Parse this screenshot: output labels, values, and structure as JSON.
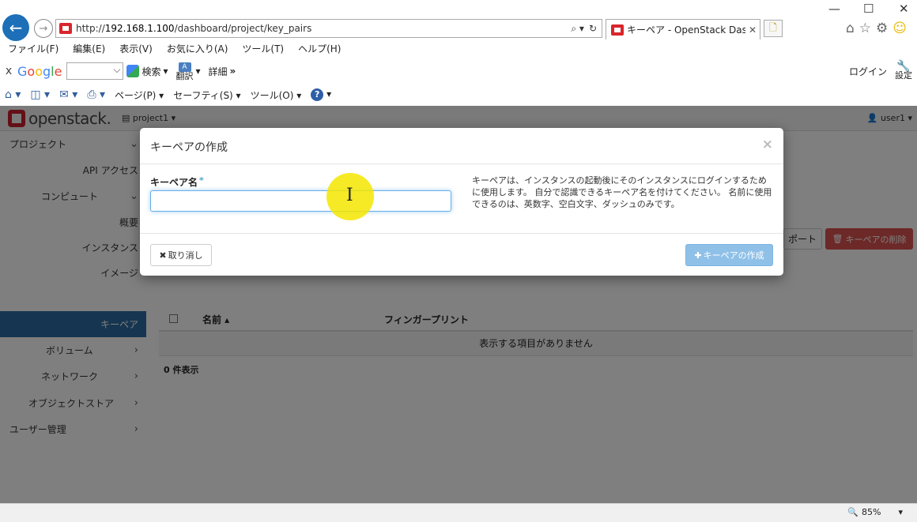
{
  "window": {
    "controls": {
      "minimize": "—",
      "maximize": "☐",
      "close": "✕"
    }
  },
  "browser": {
    "url_prefix": "http://",
    "url_host": "192.168.1.100",
    "url_path": "/dashboard/project/key_pairs",
    "addr_tools": [
      "⌕ ▾",
      "↻"
    ],
    "tab_title": "キーペア - OpenStack Dashb...",
    "tab_close": "✕",
    "new_tab": "🗋",
    "right_icons": [
      "⌂",
      "☆",
      "⚙",
      "☺"
    ],
    "menu": [
      "ファイル(F)",
      "編集(E)",
      "表示(V)",
      "お気に入り(A)",
      "ツール(T)",
      "ヘルプ(H)"
    ],
    "googlebar": {
      "close": "x",
      "logo": [
        "G",
        "o",
        "o",
        "g",
        "l",
        "e"
      ],
      "search_label": "検索",
      "translate_label": "翻訳",
      "detail_label": "詳細",
      "more": "»",
      "login": "ログイン",
      "settings": "設定"
    },
    "cmdbar": {
      "page": "ページ(P) ▾",
      "safety": "セーフティ(S) ▾",
      "tools": "ツール(O) ▾"
    },
    "zoom": "85%"
  },
  "openstack": {
    "brand": "openstack.",
    "project": "project1 ▾",
    "user": "user1 ▾"
  },
  "sidebar": {
    "items": [
      {
        "label": "プロジェクト",
        "chevron": "⌄"
      },
      {
        "label": "API アクセス"
      },
      {
        "label": "コンピュート",
        "chevron": "⌄"
      },
      {
        "label": "概要"
      },
      {
        "label": "インスタンス"
      },
      {
        "label": "イメージ"
      },
      {
        "label": "キーペア"
      },
      {
        "label": "ボリューム",
        "chevron": "›"
      },
      {
        "label": "ネットワーク",
        "chevron": "›"
      },
      {
        "label": "オブジェクトストア",
        "chevron": "›"
      },
      {
        "label": "ユーザー管理",
        "chevron": "›"
      }
    ]
  },
  "content": {
    "import_partial": "ポート",
    "delete_button": "キーペアの削除",
    "columns": {
      "name": "名前 ▴",
      "fingerprint": "フィンガープリント"
    },
    "empty": "表示する項目がありません",
    "count": "0 件表示"
  },
  "modal": {
    "title": "キーペアの作成",
    "close": "×",
    "field_label": "キーペア名",
    "required_mark": "*",
    "input_value": "",
    "help": "キーペアは、インスタンスの起動後にそのインスタンスにログインするために使用します。 自分で認識できるキーペア名を付けてください。 名前に使用できるのは、英数字、空白文字、ダッシュのみです。",
    "cancel": "取り消し",
    "create": "キーペアの作成"
  },
  "colors": {
    "active_nav": "#2c6aa0",
    "danger": "#d9534f",
    "primary_disabled": "#8fc0e8",
    "cursor_highlight": "#f5e600"
  }
}
